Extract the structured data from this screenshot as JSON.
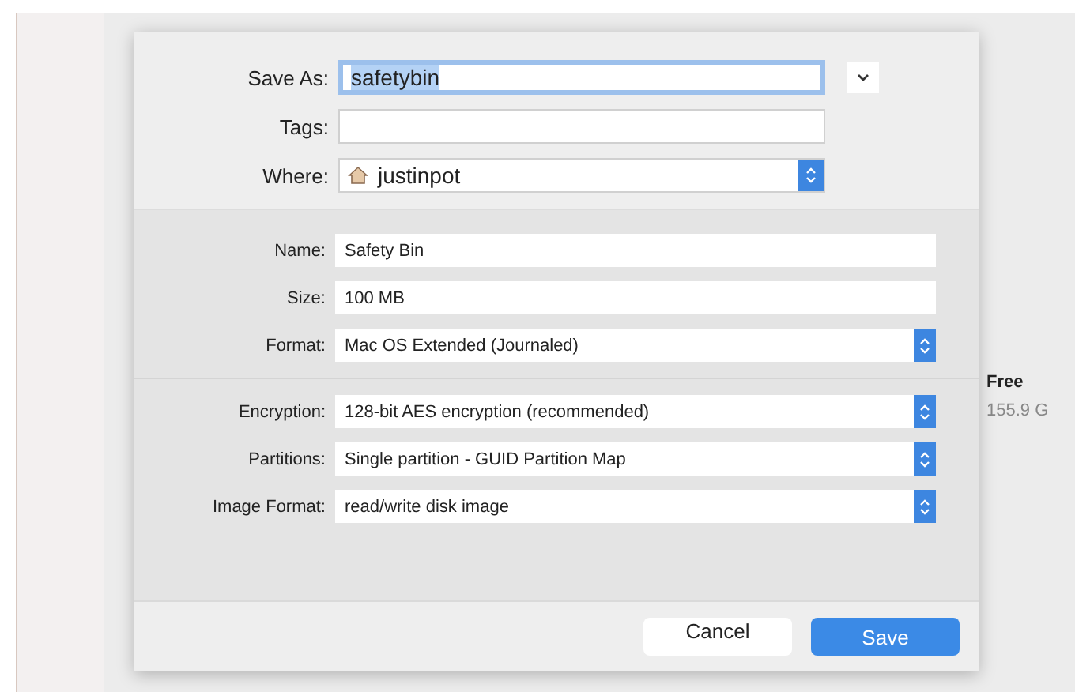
{
  "background": {
    "column_heading": "Free",
    "column_value": "155.9 G"
  },
  "dialog": {
    "save_as": {
      "label": "Save As:",
      "value": "safetybin",
      "focused": true
    },
    "tags": {
      "label": "Tags:"
    },
    "where": {
      "label": "Where:",
      "value": "justinpot"
    },
    "sections": [
      [
        {
          "kind": "text",
          "label": "Name:",
          "value": "Safety Bin"
        },
        {
          "kind": "text",
          "label": "Size:",
          "value": "100 MB"
        },
        {
          "kind": "popup",
          "label": "Format:",
          "value": "Mac OS Extended (Journaled)"
        }
      ],
      [
        {
          "kind": "popup",
          "label": "Encryption:",
          "value": "128-bit AES encryption (recommended)"
        },
        {
          "kind": "popup",
          "label": "Partitions:",
          "value": "Single partition - GUID Partition Map"
        },
        {
          "kind": "popup",
          "label": "Image Format:",
          "value": "read/write disk image"
        }
      ]
    ],
    "buttons": [
      {
        "label": "Cancel",
        "kind": "secondary"
      },
      {
        "label": "Save",
        "kind": "default"
      }
    ]
  }
}
